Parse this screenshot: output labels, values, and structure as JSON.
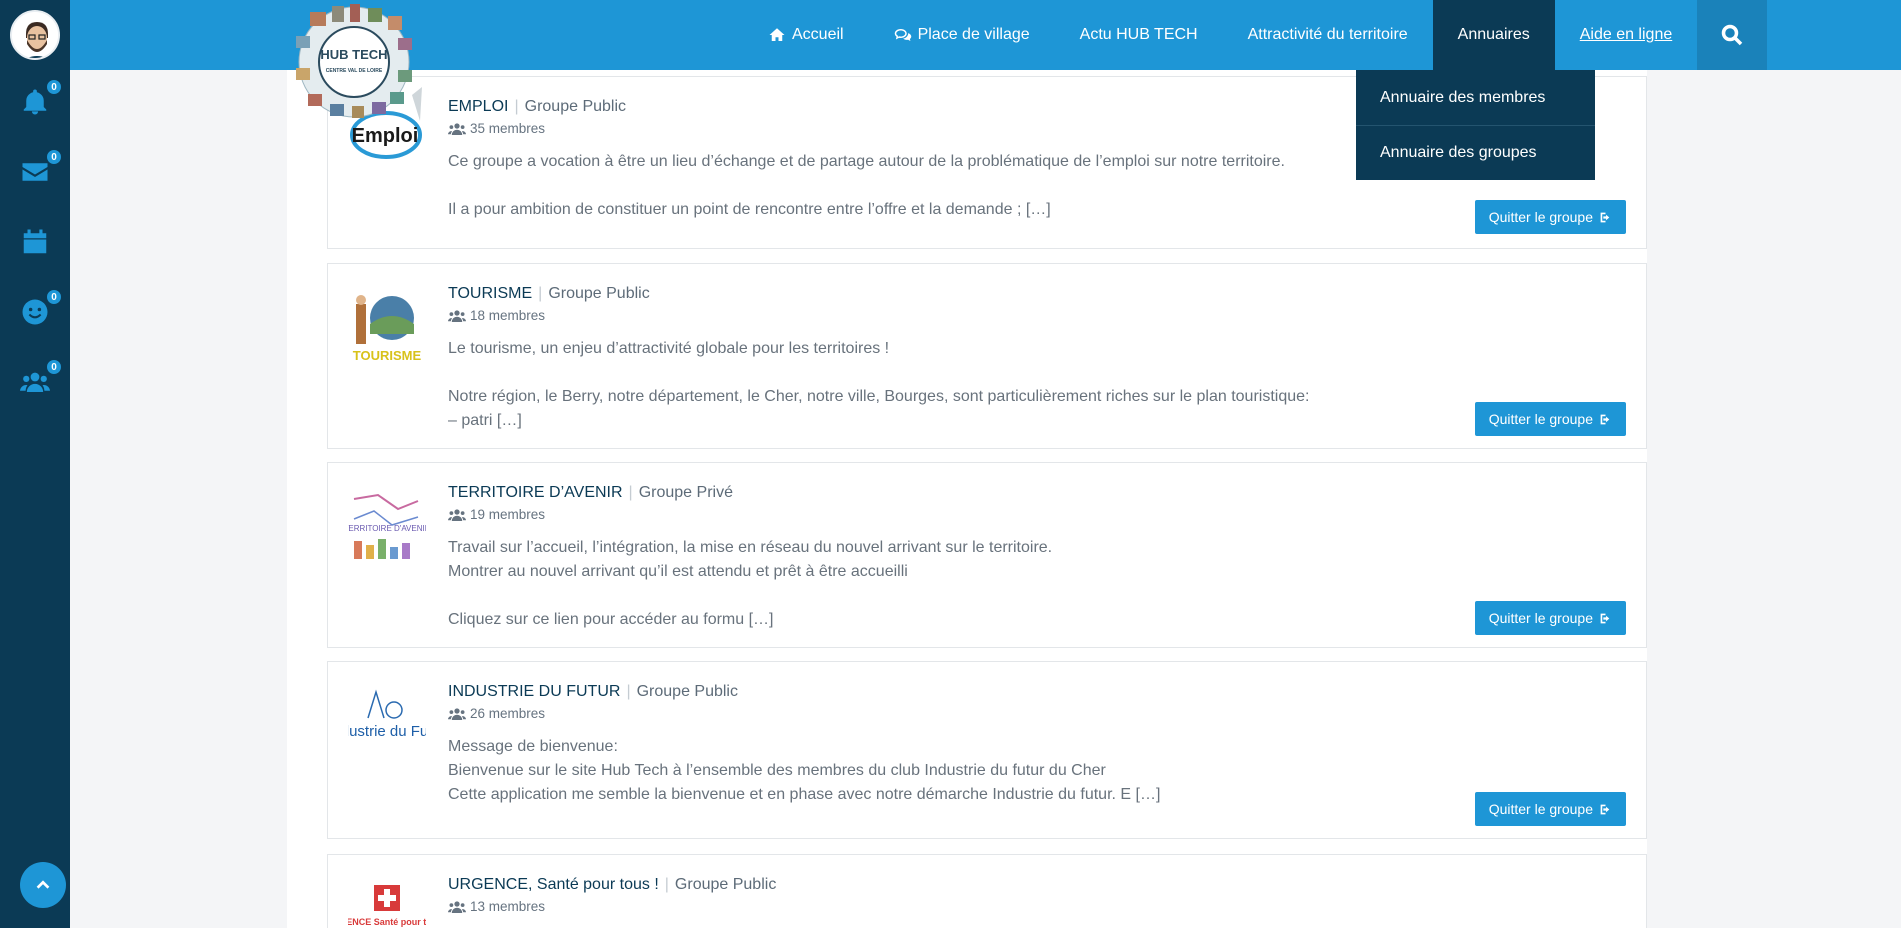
{
  "sidebar": {
    "badges": {
      "notifications": "0",
      "messages": "0",
      "friends": "0",
      "groups": "0"
    }
  },
  "nav": {
    "items": [
      {
        "label": "Accueil"
      },
      {
        "label": "Place de village"
      },
      {
        "label": "Actu HUB TECH"
      },
      {
        "label": "Attractivité du territoire"
      },
      {
        "label": "Annuaires"
      },
      {
        "label": "Aide en ligne"
      }
    ]
  },
  "logo": {
    "text": "HUB TECH",
    "subtext": "CENTRE VAL DE LOIRE"
  },
  "dropdown": {
    "items": [
      {
        "label": "Annuaire des membres"
      },
      {
        "label": "Annuaire des groupes"
      }
    ]
  },
  "groups": [
    {
      "name": "EMPLOI",
      "type": "Groupe Public",
      "members": "35 membres",
      "thumb": "Emploi",
      "desc": [
        "Ce groupe a vocation à être un lieu d’échange et de partage autour de la problématique de l’emploi sur notre territoire.",
        "",
        "Il a pour ambition de constituer un point de rencontre entre l’offre et la demande ; […]"
      ],
      "button": "Quitter le groupe"
    },
    {
      "name": "TOURISME",
      "type": "Groupe Public",
      "members": "18 membres",
      "thumb": "TOURISME",
      "desc": [
        "Le tourisme, un enjeu d’attractivité globale pour les territoires !",
        "",
        "Notre région, le Berry, notre département, le Cher, notre ville, Bourges, sont particulièrement riches sur le plan touristique:",
        "– patri […]"
      ],
      "button": "Quitter le groupe"
    },
    {
      "name": "TERRITOIRE D’AVENIR",
      "type": "Groupe Privé",
      "members": "19 membres",
      "thumb": "TERRITOIRE D'AVENIR",
      "desc": [
        "Travail sur l’accueil, l’intégration, la mise en réseau du nouvel arrivant sur le territoire.",
        "Montrer au nouvel arrivant qu’il est attendu et prêt à être accueilli",
        "",
        "Cliquez sur ce lien pour accéder au formu […]"
      ],
      "button": "Quitter le groupe"
    },
    {
      "name": "INDUSTRIE DU FUTUR",
      "type": "Groupe Public",
      "members": "26 membres",
      "thumb": "Industrie du Futur",
      "desc": [
        "Message de bienvenue:",
        "Bienvenue sur le site Hub Tech à l’ensemble des membres du club Industrie du futur du Cher",
        "Cette application me semble la bienvenue et en phase avec notre démarche Industrie du futur. E […]"
      ],
      "button": "Quitter le groupe"
    },
    {
      "name": "URGENCE, Santé pour tous !",
      "type": "Groupe Public",
      "members": "13 membres",
      "thumb": "URGENCE Santé pour tous !",
      "desc": [],
      "button": ""
    }
  ]
}
